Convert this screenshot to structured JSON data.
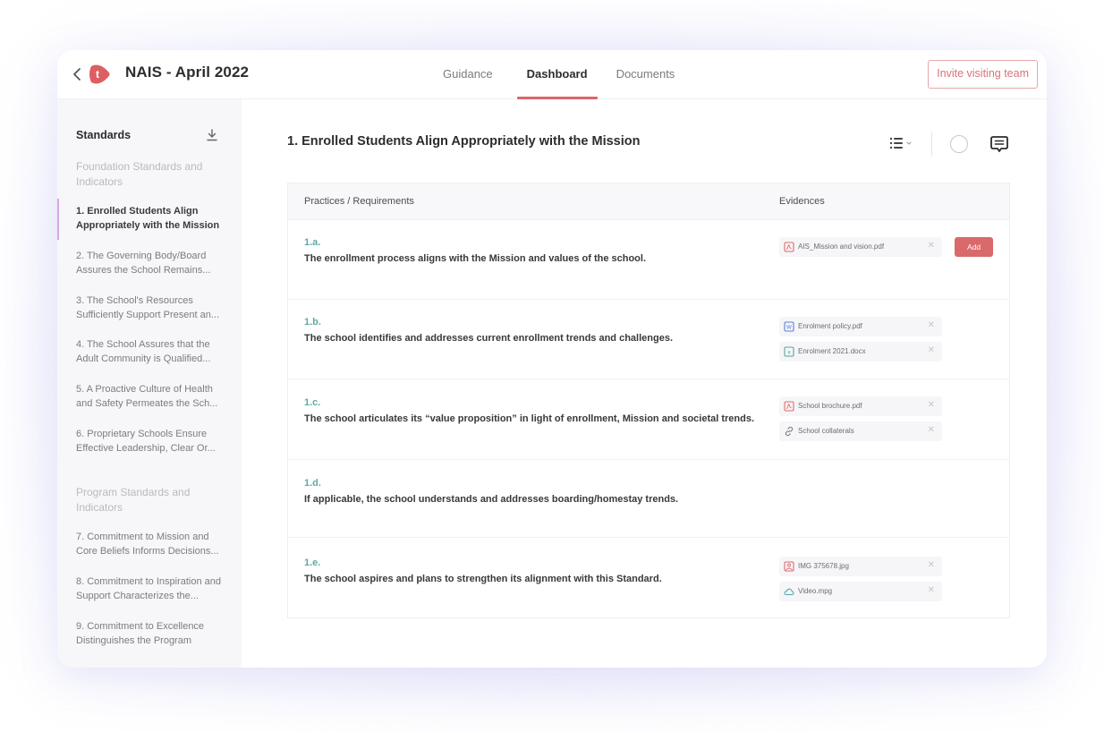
{
  "header": {
    "back_label": "‹",
    "logo_letter": "t",
    "title": "NAIS - April 2022",
    "tabs": [
      {
        "label": "Guidance",
        "active": false
      },
      {
        "label": "Dashboard",
        "active": true
      },
      {
        "label": "Documents",
        "active": false
      }
    ],
    "invite_button": "Invite visiting team"
  },
  "colors": {
    "accent": "#d9686a",
    "code_teal": "#5fa8a8",
    "active_indicator": "#d7a8e4"
  },
  "sidebar": {
    "heading": "Standards",
    "download_icon": "download-icon",
    "groups": [
      {
        "label": "Foundation Standards and Indicators",
        "items": [
          {
            "label": "1. Enrolled Students Align Appropriately with the Mission",
            "active": true
          },
          {
            "label": "2. The Governing Body/Board Assures the School Remains...",
            "active": false
          },
          {
            "label": "3. The School's Resources Sufficiently Support Present an...",
            "active": false
          },
          {
            "label": "4. The School Assures that the Adult Community is Qualified...",
            "active": false
          },
          {
            "label": "5. A Proactive Culture of Health and Safety Permeates the Sch...",
            "active": false
          },
          {
            "label": "6. Proprietary Schools Ensure Effective Leadership, Clear Or...",
            "active": false
          }
        ]
      },
      {
        "label": "Program Standards and Indicators",
        "items": [
          {
            "label": "7. Commitment to Mission and Core Beliefs Informs Decisions...",
            "active": false
          },
          {
            "label": "8. Commitment to Inspiration and Support Characterizes the...",
            "active": false
          },
          {
            "label": "9. Commitment to Excellence Distinguishes the Program",
            "active": false
          }
        ]
      }
    ]
  },
  "main": {
    "title": "1. Enrolled Students Align Appropriately with the Mission",
    "toolbar": [
      "list-view-icon",
      "status-circle-icon",
      "comment-icon"
    ],
    "table": {
      "headers": {
        "practices": "Practices / Requirements",
        "evidences": "Evidences"
      },
      "add_label": "Add",
      "rows": [
        {
          "code": "1.a.",
          "text": "The enrollment process aligns with the Mission and values of the school.",
          "evidences": [
            {
              "name": "AIS_Mission and vision.pdf",
              "type": "pdf"
            }
          ],
          "has_add": true
        },
        {
          "code": "1.b.",
          "text": "The school identifies and addresses current enrollment trends and challenges.",
          "evidences": [
            {
              "name": "Enrolment policy.pdf",
              "type": "word"
            },
            {
              "name": "Enrolment 2021.docx",
              "type": "excel"
            }
          ]
        },
        {
          "code": "1.c.",
          "text": "The school articulates its “value proposition” in light of enrollment, Mission and societal trends.",
          "evidences": [
            {
              "name": "School brochure.pdf",
              "type": "pdf"
            },
            {
              "name": "School collaterals",
              "type": "link"
            }
          ]
        },
        {
          "code": "1.d.",
          "text": "If applicable, the school understands and addresses boarding/homestay trends.",
          "evidences": []
        },
        {
          "code": "1.e.",
          "text": "The school aspires and plans to strengthen its alignment with this Standard.",
          "evidences": [
            {
              "name": "IMG 375678.jpg",
              "type": "image"
            },
            {
              "name": "Video.mpg",
              "type": "cloud"
            }
          ]
        }
      ]
    }
  }
}
